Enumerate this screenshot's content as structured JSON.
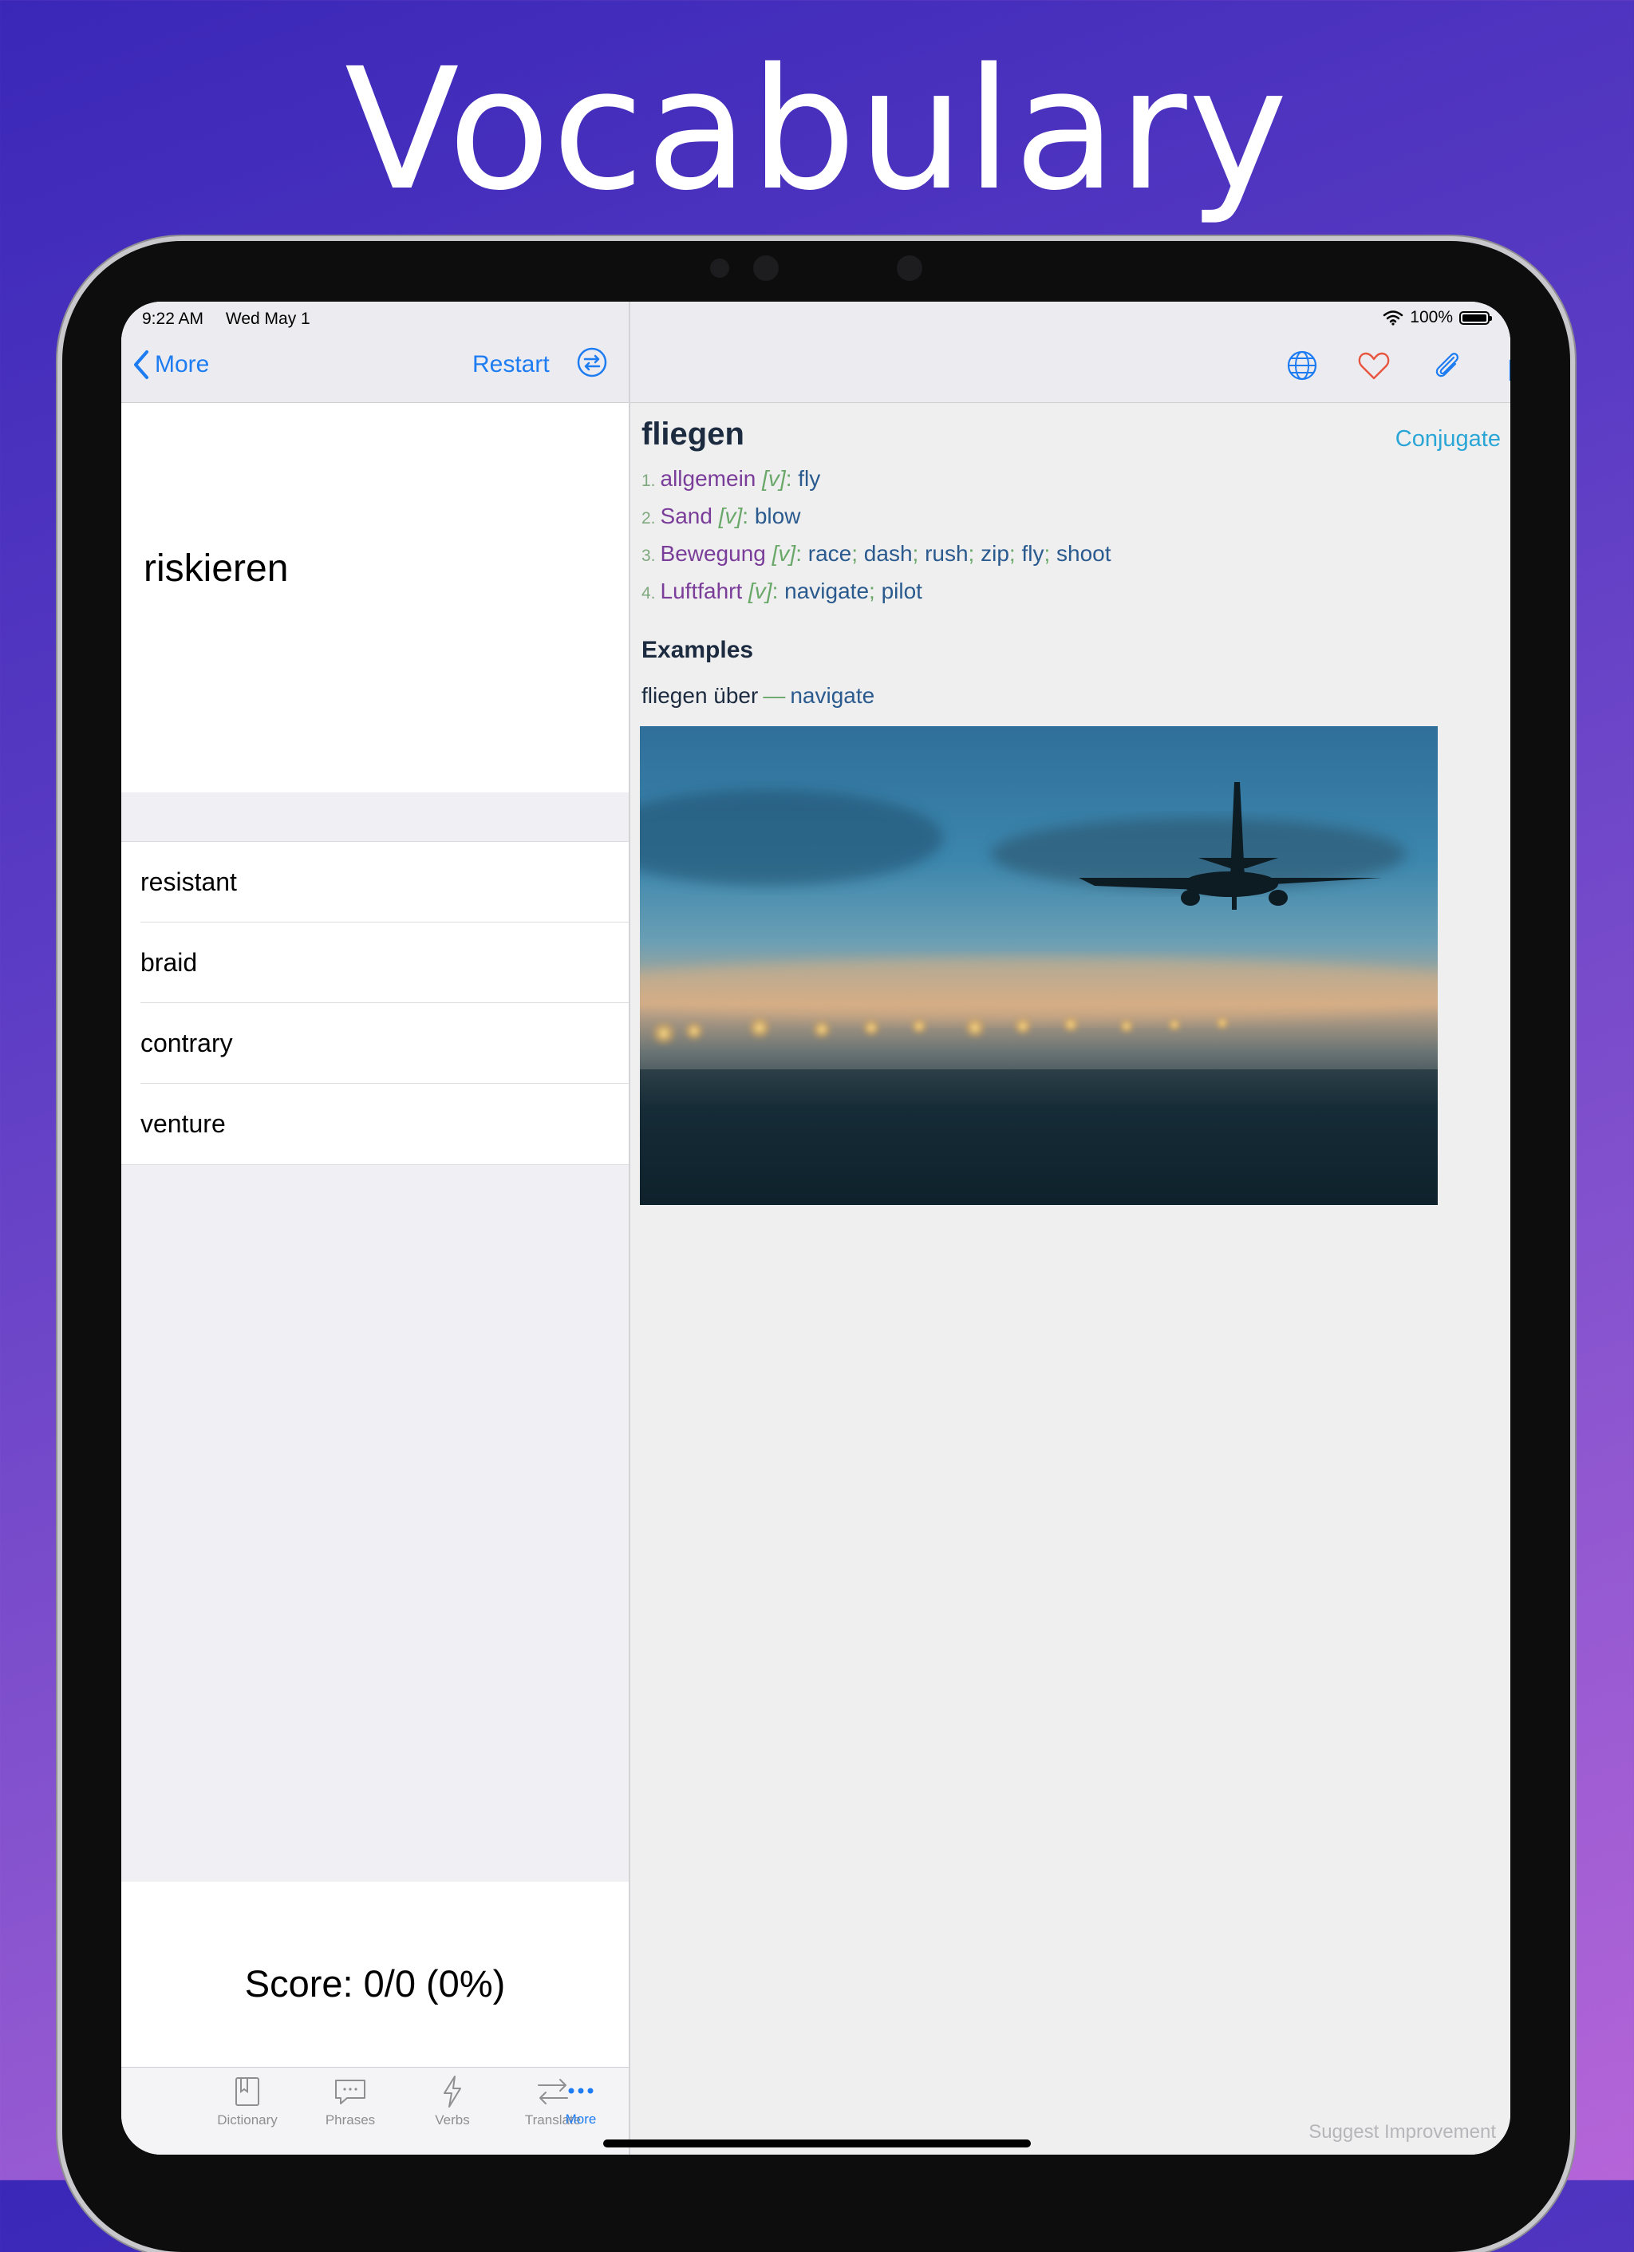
{
  "promo": {
    "title": "Vocabulary"
  },
  "status_bar": {
    "time": "9:22 AM",
    "date": "Wed May 1",
    "battery": "100%"
  },
  "left_nav": {
    "back_label": "More",
    "restart_label": "Restart"
  },
  "quiz": {
    "question": "riskieren",
    "answers": [
      "resistant",
      "braid",
      "contrary",
      "venture"
    ],
    "score": "Score: 0/0 (0%)"
  },
  "tabs": [
    {
      "label": "Dictionary",
      "icon": "book-icon"
    },
    {
      "label": "Phrases",
      "icon": "chat-bubble-icon"
    },
    {
      "label": "Verbs",
      "icon": "lightning-icon"
    },
    {
      "label": "Translate",
      "icon": "swap-arrows-icon"
    },
    {
      "label": "More",
      "icon": "more-dots-icon",
      "active": true
    }
  ],
  "entry": {
    "headword": "fliegen",
    "conjugate_label": "Conjugate",
    "senses": [
      {
        "num": "1.",
        "field": "allgemein",
        "pos": "[v]",
        "translations": [
          "fly"
        ]
      },
      {
        "num": "2.",
        "field": "Sand",
        "pos": "[v]",
        "translations": [
          "blow"
        ]
      },
      {
        "num": "3.",
        "field": "Bewegung",
        "pos": "[v]",
        "translations": [
          "race",
          "dash",
          "rush",
          "zip",
          "fly",
          "shoot"
        ]
      },
      {
        "num": "4.",
        "field": "Luftfahrt",
        "pos": "[v]",
        "translations": [
          "navigate",
          "pilot"
        ]
      }
    ],
    "examples_title": "Examples",
    "example": {
      "source": "fliegen über",
      "dash": "—",
      "target": "navigate"
    }
  },
  "footer": {
    "suggest_label": "Suggest Improvement"
  },
  "colors": {
    "accent": "#1d7cf2",
    "heart": "#e8553f",
    "field": "#7a3d9a",
    "translation": "#2a5a8e",
    "pos": "#6aa86a"
  }
}
